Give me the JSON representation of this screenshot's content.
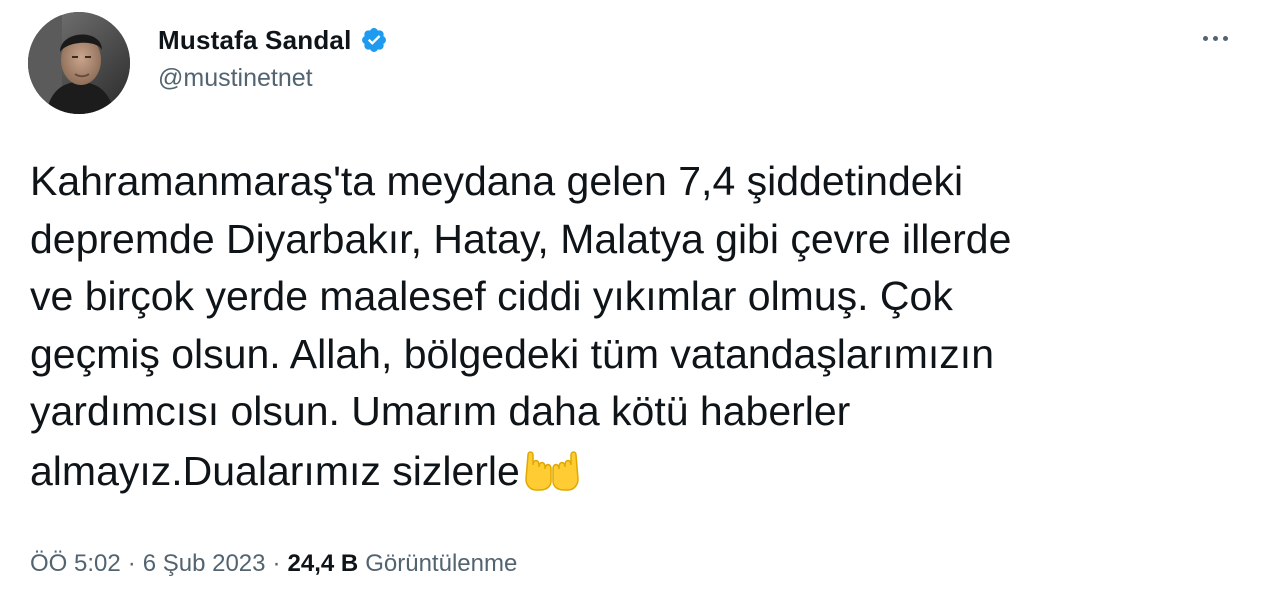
{
  "author": {
    "name": "Mustafa Sandal",
    "handle": "@mustinetnet",
    "verified": true,
    "verified_color": "#1d9bf0"
  },
  "tweet": {
    "lines": [
      "Kahramanmaraş'ta meydana gelen 7,4 şiddetindeki",
      "depremde Diyarbakır, Hatay, Malatya gibi çevre illerde",
      "ve birçok yerde maalesef ciddi yıkımlar olmuş. Çok",
      "geçmiş olsun. Allah, bölgedeki tüm vatandaşlarımızın",
      "yardımcısı olsun. Umarım daha kötü haberler",
      "almayız.Dualarımız sizlerle"
    ],
    "trailing_emoji": "palms-up-together-icon"
  },
  "meta": {
    "time": "ÖÖ 5:02",
    "separator": "·",
    "date": "6 Şub 2023",
    "views_count": "24,4 B",
    "views_label": "Görüntülenme"
  },
  "icons": {
    "more": "more-horizontal-icon",
    "verified": "verified-badge-icon"
  },
  "colors": {
    "text_primary": "#0f1419",
    "text_secondary": "#536471",
    "emoji_yellow": "#ffcc33"
  }
}
